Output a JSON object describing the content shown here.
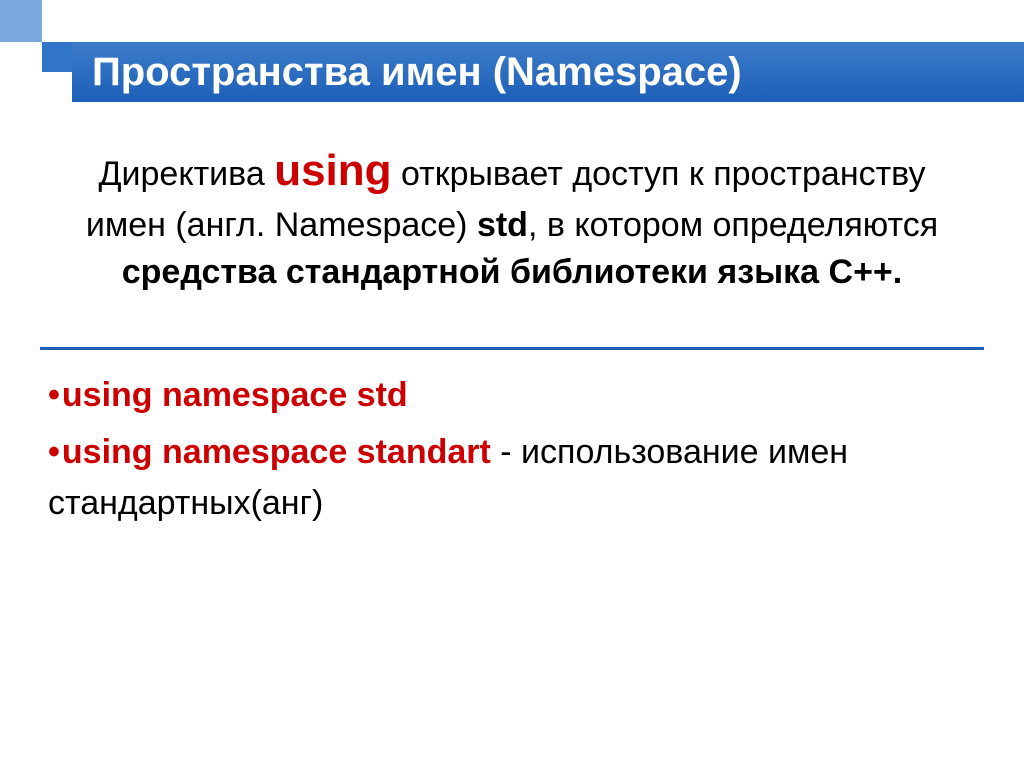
{
  "title": "Пространства имен (Namespace)",
  "paragraph": {
    "p1": "Директива ",
    "using": "using",
    "p2": " открывает доступ к пространству имен (англ. Namespace) ",
    "std": "std",
    "p3": ", в котором определяются ",
    "bold1": "средства стандартной библиотеки языка С++.",
    "p4": ""
  },
  "bullets": {
    "b1_code": "using namespace std",
    "b2_code": "using namespace standart",
    "b2_rest": " - использование имен стандартных(анг)"
  }
}
